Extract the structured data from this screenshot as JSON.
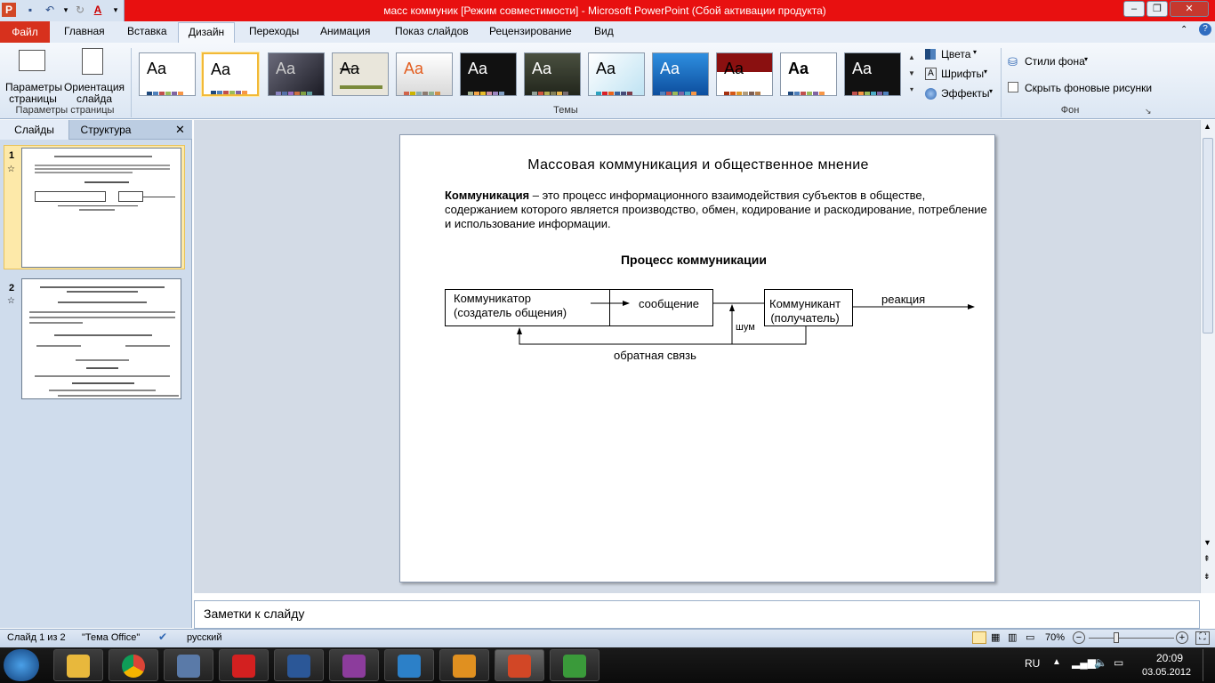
{
  "titlebar": {
    "title": "масс коммуник [Режим совместимости] - Microsoft PowerPoint (Сбой активации продукта)"
  },
  "ribbon_tabs": [
    "Файл",
    "Главная",
    "Вставка",
    "Дизайн",
    "Переходы",
    "Анимация",
    "Показ слайдов",
    "Рецензирование",
    "Вид"
  ],
  "ribbon": {
    "page_setup_label": "Параметры страницы",
    "orientation_label": "Ориентация слайда",
    "group_page_setup": "Параметры страницы",
    "group_themes": "Темы",
    "colors": "Цвета",
    "fonts": "Шрифты",
    "effects": "Эффекты",
    "bg_styles": "Стили фона",
    "hide_bg": "Скрыть фоновые рисунки",
    "group_background": "Фон",
    "theme_glyph": "Aa"
  },
  "panel": {
    "tab_slides": "Слайды",
    "tab_outline": "Структура",
    "slide1_num": "1",
    "slide2_num": "2"
  },
  "slide": {
    "title": "Массовая коммуникация и общественное мнение",
    "def_term": "Коммуникация",
    "def_text": " – это процесс информационного взаимодействия субъектов в обществе, содержанием которого является производство, обмен, кодирование и раскодирование, потребление и использование информации.",
    "process_title": "Процесс коммуникации",
    "communicator_line1": "Коммуникатор",
    "communicator_line2": "(создатель общения)",
    "message": "сообщение",
    "recipient_line1": "Коммуникант",
    "recipient_line2": "(получатель)",
    "reaction": "реакция",
    "noise": "шум",
    "feedback": "обратная связь"
  },
  "notes": {
    "placeholder": "Заметки к слайду"
  },
  "status": {
    "slide_counter": "Слайд 1 из 2",
    "theme": "\"Тема Office\"",
    "language": "русский",
    "zoom": "70%"
  },
  "taskbar": {
    "lang": "RU",
    "time": "20:09",
    "date": "03.05.2012"
  }
}
